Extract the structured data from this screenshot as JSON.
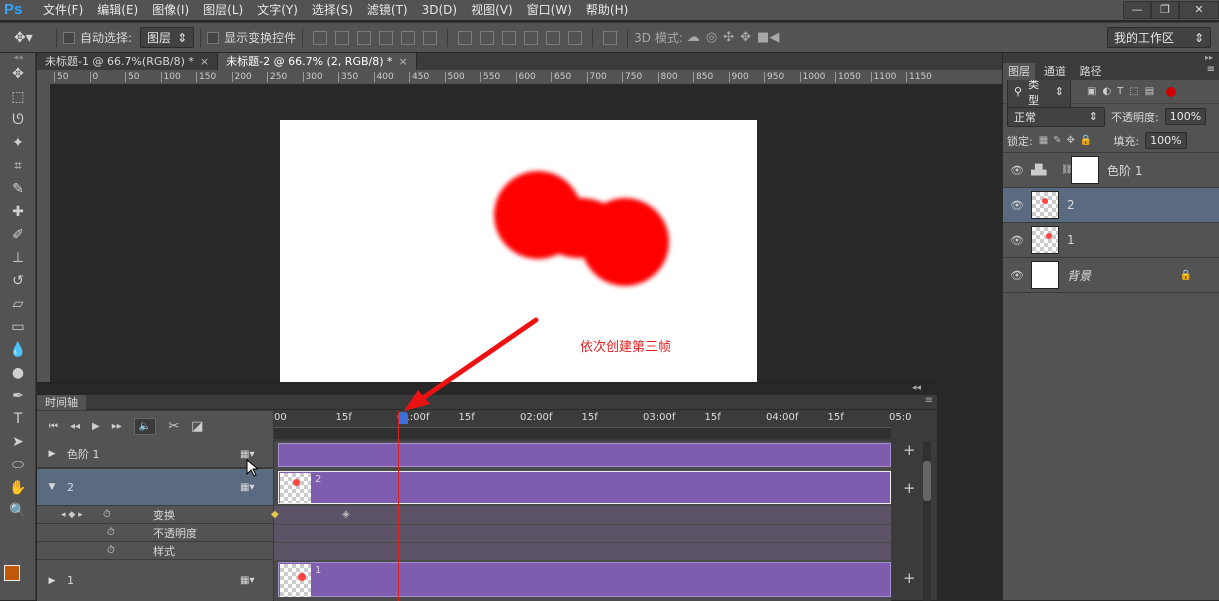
{
  "app": {
    "logo": "Ps"
  },
  "menu": [
    "文件(F)",
    "编辑(E)",
    "图像(I)",
    "图层(L)",
    "文字(Y)",
    "选择(S)",
    "滤镜(T)",
    "3D(D)",
    "视图(V)",
    "窗口(W)",
    "帮助(H)"
  ],
  "window_controls": [
    "—",
    "❐",
    "✕"
  ],
  "options": {
    "auto_select_label": "自动选择:",
    "auto_select_value": "图层",
    "show_transform_label": "显示变换控件",
    "mode3d_label": "3D 模式:",
    "workspace": "我的工作区"
  },
  "doc_tabs": [
    {
      "label": "未标题-1 @ 66.7%(RGB/8) *",
      "close": "×"
    },
    {
      "label": "未标题-2 @ 66.7% (2, RGB/8) *",
      "close": "×"
    }
  ],
  "ruler_ticks": [
    "50",
    "0",
    "50",
    "100",
    "150",
    "200",
    "250",
    "300",
    "350",
    "400",
    "450",
    "500",
    "550",
    "600",
    "650",
    "700",
    "750",
    "800",
    "850",
    "900",
    "950",
    "1000",
    "1050",
    "1100",
    "1150"
  ],
  "annotation": "依次创建第三帧",
  "timeline": {
    "panel_title": "时间轴",
    "time_labels": [
      "00",
      "15f",
      "01:00f",
      "15f",
      "02:00f",
      "15f",
      "03:00f",
      "15f",
      "04:00f",
      "15f",
      "05:0"
    ],
    "layers": [
      {
        "name": "色阶 1"
      },
      {
        "name": "2"
      },
      {
        "name": "1"
      }
    ],
    "props": [
      "变换",
      "不透明度",
      "样式"
    ],
    "track_labels": {
      "layer2": "2",
      "layer1": "1"
    },
    "add_symbol": "+"
  },
  "layers_panel": {
    "tabs": [
      "图层",
      "通道",
      "路径"
    ],
    "filter": "类型",
    "blend_mode": "正常",
    "opacity_label": "不透明度:",
    "opacity_value": "100%",
    "lock_label": "锁定:",
    "fill_label": "填充:",
    "fill_value": "100%",
    "layers": [
      {
        "name": "色阶 1"
      },
      {
        "name": "2"
      },
      {
        "name": "1"
      },
      {
        "name": "背景"
      }
    ]
  },
  "colors": {
    "accent_bar": "#7e5cae",
    "selected_row": "#5a6a80",
    "fg_color": "#c0580a"
  }
}
